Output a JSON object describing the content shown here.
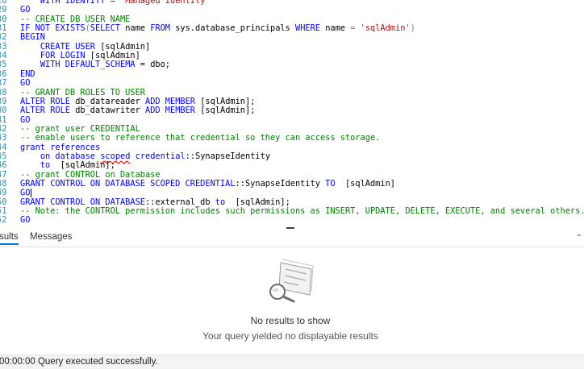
{
  "editor": {
    "lines": [
      {
        "num": "28",
        "segs": [
          {
            "t": "    WITH IDENTITY = ",
            "c": "kw"
          },
          {
            "t": "'Managed Identity'",
            "c": "str"
          }
        ]
      },
      {
        "num": "29",
        "segs": [
          {
            "t": "GO",
            "c": "kw"
          }
        ]
      },
      {
        "num": "30",
        "segs": [
          {
            "t": "-- CREATE DB USER NAME",
            "c": "cm"
          }
        ]
      },
      {
        "num": "31",
        "segs": [
          {
            "t": "IF NOT EXISTS",
            "c": "kw"
          },
          {
            "t": "(",
            "c": "gr"
          },
          {
            "t": "SELECT",
            "c": "kw"
          },
          {
            "t": " name ",
            "c": "tx"
          },
          {
            "t": "FROM",
            "c": "kw"
          },
          {
            "t": " sys.database_principals ",
            "c": "tx"
          },
          {
            "t": "WHERE",
            "c": "kw"
          },
          {
            "t": " name ",
            "c": "tx"
          },
          {
            "t": "=",
            "c": "gr"
          },
          {
            "t": " 'sqlAdmin'",
            "c": "str"
          },
          {
            "t": ")",
            "c": "gr"
          }
        ]
      },
      {
        "num": "32",
        "segs": [
          {
            "t": "BEGIN",
            "c": "kw"
          }
        ]
      },
      {
        "num": "33",
        "segs": [
          {
            "t": "    ",
            "c": "tx"
          },
          {
            "t": "CREATE USER",
            "c": "kw"
          },
          {
            "t": " [sqlAdmin]",
            "c": "tx"
          }
        ]
      },
      {
        "num": "34",
        "segs": [
          {
            "t": "    ",
            "c": "tx"
          },
          {
            "t": "FOR LOGIN",
            "c": "kw"
          },
          {
            "t": " [sqlAdmin]",
            "c": "tx"
          }
        ]
      },
      {
        "num": "35",
        "segs": [
          {
            "t": "    ",
            "c": "tx"
          },
          {
            "t": "WITH DEFAULT_SCHEMA",
            "c": "kw"
          },
          {
            "t": " = dbo;",
            "c": "tx"
          }
        ]
      },
      {
        "num": "36",
        "segs": [
          {
            "t": "END",
            "c": "kw"
          }
        ]
      },
      {
        "num": "37",
        "segs": [
          {
            "t": "GO",
            "c": "kw"
          }
        ]
      },
      {
        "num": "38",
        "segs": [
          {
            "t": "-- GRANT DB ROLES TO USER",
            "c": "cm"
          }
        ]
      },
      {
        "num": "39",
        "segs": [
          {
            "t": "ALTER ROLE",
            "c": "kw"
          },
          {
            "t": " db_datareader ",
            "c": "tx"
          },
          {
            "t": "ADD MEMBER",
            "c": "kw"
          },
          {
            "t": " [sqlAdmin];",
            "c": "tx"
          }
        ]
      },
      {
        "num": "40",
        "segs": [
          {
            "t": "ALTER ROLE",
            "c": "kw"
          },
          {
            "t": " db_datawriter ",
            "c": "tx"
          },
          {
            "t": "ADD MEMBER",
            "c": "kw"
          },
          {
            "t": " [sqlAdmin];",
            "c": "tx"
          }
        ]
      },
      {
        "num": "41",
        "segs": [
          {
            "t": "GO",
            "c": "kw"
          }
        ]
      },
      {
        "num": "42",
        "segs": [
          {
            "t": "-- grant user CREDENTIAL",
            "c": "cm"
          }
        ]
      },
      {
        "num": "43",
        "segs": [
          {
            "t": "-- enable users to reference that credential so they can access storage.",
            "c": "cm"
          }
        ]
      },
      {
        "num": "44",
        "segs": [
          {
            "t": "grant references",
            "c": "kw"
          }
        ]
      },
      {
        "num": "45",
        "segs": [
          {
            "t": "    ",
            "c": "tx"
          },
          {
            "t": "on database ",
            "c": "kw"
          },
          {
            "t": "scoped",
            "c": "kw err"
          },
          {
            "t": " credential",
            "c": "kw"
          },
          {
            "t": "::SynapseIdentity",
            "c": "tx"
          }
        ]
      },
      {
        "num": "46",
        "segs": [
          {
            "t": "    ",
            "c": "tx"
          },
          {
            "t": "to",
            "c": "kw"
          },
          {
            "t": "  [sqlAdmin];",
            "c": "tx"
          }
        ]
      },
      {
        "num": "47",
        "segs": [
          {
            "t": "-- grant CONTROL on Database",
            "c": "cm"
          }
        ]
      },
      {
        "num": "48",
        "segs": [
          {
            "t": "GRANT CONTROL ON DATABASE SCOPED CREDENTIAL",
            "c": "kw"
          },
          {
            "t": "::SynapseIdentity ",
            "c": "tx"
          },
          {
            "t": "TO",
            "c": "kw"
          },
          {
            "t": "  [sqlAdmin]",
            "c": "tx"
          }
        ]
      },
      {
        "num": "49",
        "segs": [
          {
            "t": "GO",
            "c": "kw"
          }
        ],
        "caret": true
      },
      {
        "num": "50",
        "segs": [
          {
            "t": "GRANT CONTROL ON DATABASE",
            "c": "kw"
          },
          {
            "t": "::external_db ",
            "c": "tx"
          },
          {
            "t": "to",
            "c": "kw"
          },
          {
            "t": "  [sqlAdmin];",
            "c": "tx"
          }
        ]
      },
      {
        "num": "51",
        "segs": [
          {
            "t": "-- Note: the CONTROL permission includes such permissions as INSERT, UPDATE, DELETE, EXECUTE, and several others.",
            "c": "cm"
          }
        ]
      },
      {
        "num": "52",
        "segs": [
          {
            "t": "GO",
            "c": "kw"
          }
        ]
      }
    ]
  },
  "tabs": {
    "results_label": "sults",
    "messages_label": "Messages"
  },
  "results": {
    "empty_title": "No results to show",
    "empty_subtitle": "Your query yielded no displayable results"
  },
  "status": {
    "text": "00:00:00 Query executed successfully."
  }
}
